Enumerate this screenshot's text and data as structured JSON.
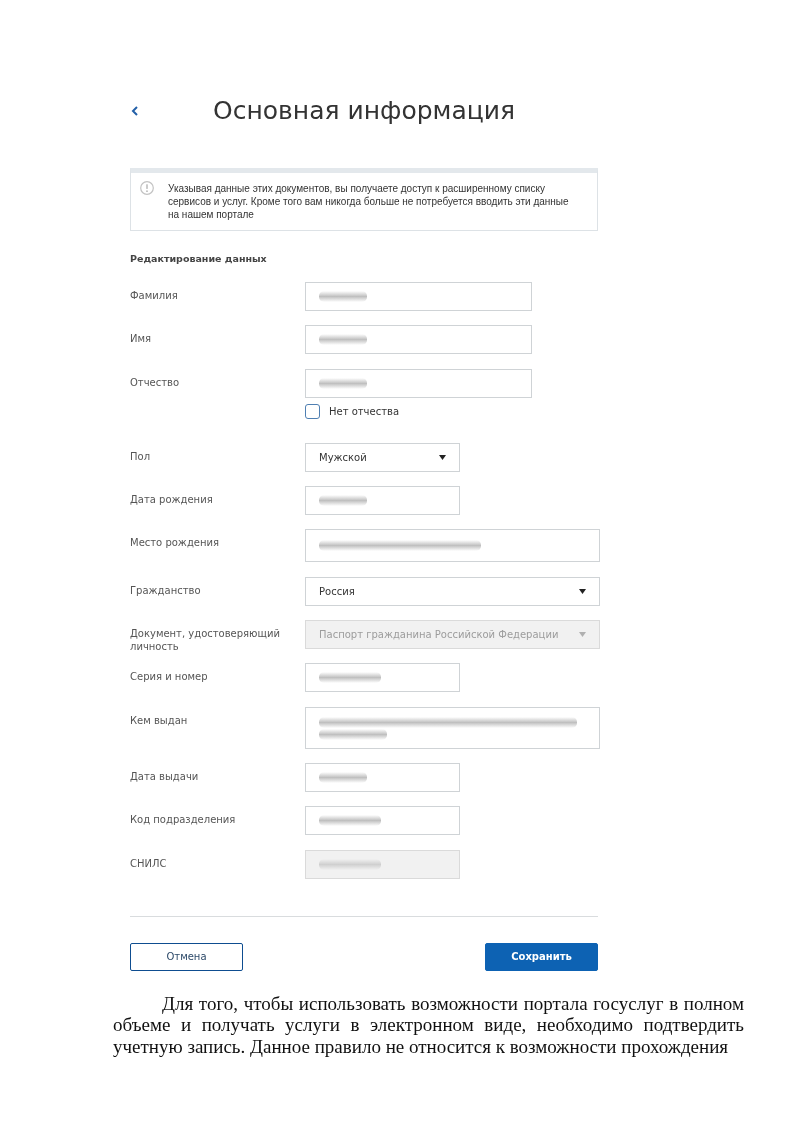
{
  "header": {
    "title": "Основная информация"
  },
  "notice": {
    "text": "Указывая данные этих документов, вы получаете доступ к расширенному списку сервисов и услуг. Кроме того вам никогда больше не потребуется вводить эти данные на нашем портале"
  },
  "form": {
    "section_title": "Редактирование данных",
    "fields": [
      {
        "label": "Фамилия",
        "kind": "text",
        "blurred": true,
        "disabled": false
      },
      {
        "label": "Имя",
        "kind": "text",
        "blurred": true,
        "disabled": false
      },
      {
        "label": "Отчество",
        "kind": "text",
        "blurred": true,
        "disabled": false,
        "option": {
          "label": "Нет отчества",
          "checked": false
        }
      },
      {
        "label": "Пол",
        "kind": "select",
        "value": "Мужской",
        "disabled": false
      },
      {
        "label": "Дата рождения",
        "kind": "date",
        "blurred": true,
        "disabled": false
      },
      {
        "label": "Место рождения",
        "kind": "longtext",
        "blurred": true,
        "disabled": false
      },
      {
        "label": "Гражданство",
        "kind": "longselect",
        "value": "Россия",
        "disabled": false
      },
      {
        "label": "Документ, удостоверяющий личность",
        "kind": "longselect",
        "value": "Паспорт гражданина Российской Федерации",
        "disabled": true
      },
      {
        "label": "Серия и номер",
        "kind": "number",
        "blurred": true,
        "disabled": false
      },
      {
        "label": "Кем выдан",
        "kind": "textarea",
        "blurred": true,
        "disabled": false
      },
      {
        "label": "Дата выдачи",
        "kind": "date",
        "blurred": true,
        "disabled": false
      },
      {
        "label": "Код подразделения",
        "kind": "number",
        "blurred": true,
        "disabled": false
      },
      {
        "label": "СНИЛС",
        "kind": "number",
        "blurred": true,
        "disabled": true
      }
    ]
  },
  "actions": [
    {
      "label": "Отмена",
      "kind": "secondary"
    },
    {
      "label": "Сохранить",
      "kind": "primary"
    }
  ],
  "paragraph": "Для того, чтобы использовать возможности портала госуслуг в полном объеме и получать услуги в электронном виде, необходимо подтвердить учетную запись. Данное правило не относится к возможности прохождения"
}
